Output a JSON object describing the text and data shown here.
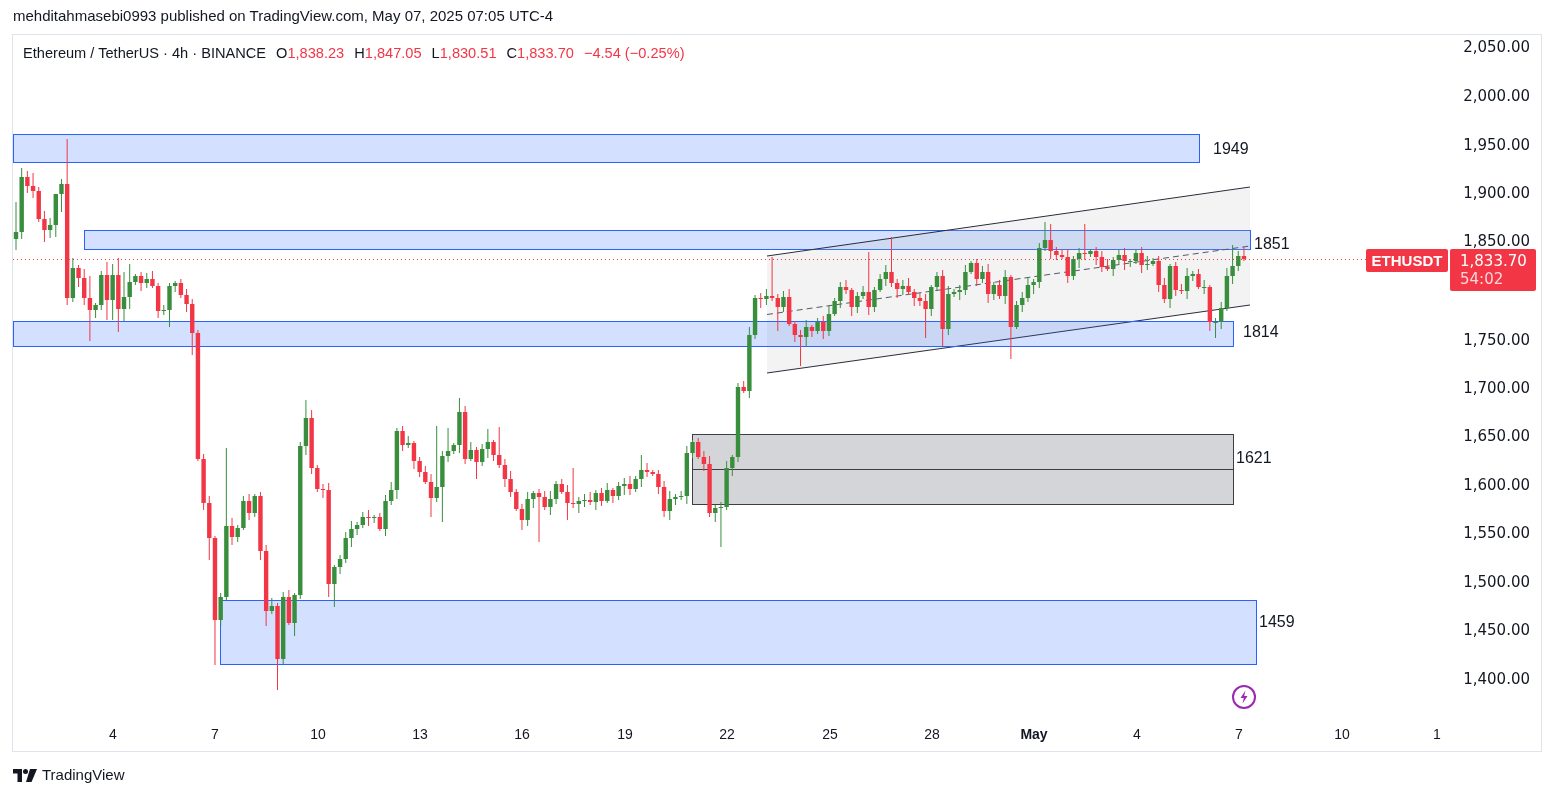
{
  "publication": {
    "text": "mehditahmasebi0993 published on TradingView.com, May 07, 2025 07:05 UTC-4"
  },
  "chart": {
    "legend": {
      "title": "Ethereum / TetherUS · 4h · BINANCE",
      "ohlc": [
        {
          "label": "O",
          "value": "1,838.23"
        },
        {
          "label": "H",
          "value": "1,847.05"
        },
        {
          "label": "L",
          "value": "1,830.51"
        },
        {
          "label": "C",
          "value": "1,833.70"
        }
      ],
      "change": "−4.54 (−0.25%)"
    },
    "drawings": [
      {
        "kind": "zone",
        "label": "1949"
      },
      {
        "kind": "zone",
        "label": "1851"
      },
      {
        "kind": "channel"
      },
      {
        "kind": "zone",
        "label": "1814"
      },
      {
        "kind": "range",
        "label": "1621"
      },
      {
        "kind": "zone",
        "label": "1459"
      }
    ],
    "price_axis": [
      "2,050.00",
      "2,000.00",
      "1,950.00",
      "1,900.00",
      "1,850.00",
      "1,750.00",
      "1,700.00",
      "1,650.00",
      "1,600.00",
      "1,550.00",
      "1,500.00",
      "1,450.00",
      "1,400.00"
    ],
    "last_price": {
      "symbol": "ETHUSDT",
      "price": "1,833.70",
      "countdown": "54:02"
    },
    "time_axis": [
      {
        "label": "4",
        "kind": "day"
      },
      {
        "label": "7",
        "kind": "day"
      },
      {
        "label": "10",
        "kind": "day"
      },
      {
        "label": "13",
        "kind": "day"
      },
      {
        "label": "16",
        "kind": "day"
      },
      {
        "label": "19",
        "kind": "day"
      },
      {
        "label": "22",
        "kind": "day"
      },
      {
        "label": "25",
        "kind": "day"
      },
      {
        "label": "28",
        "kind": "day"
      },
      {
        "label": "May",
        "kind": "month"
      },
      {
        "label": "4",
        "kind": "day"
      },
      {
        "label": "7",
        "kind": "day"
      },
      {
        "label": "10",
        "kind": "day"
      },
      {
        "label": "1",
        "kind": "day"
      }
    ]
  },
  "footer": {
    "brand": "TradingView"
  }
}
